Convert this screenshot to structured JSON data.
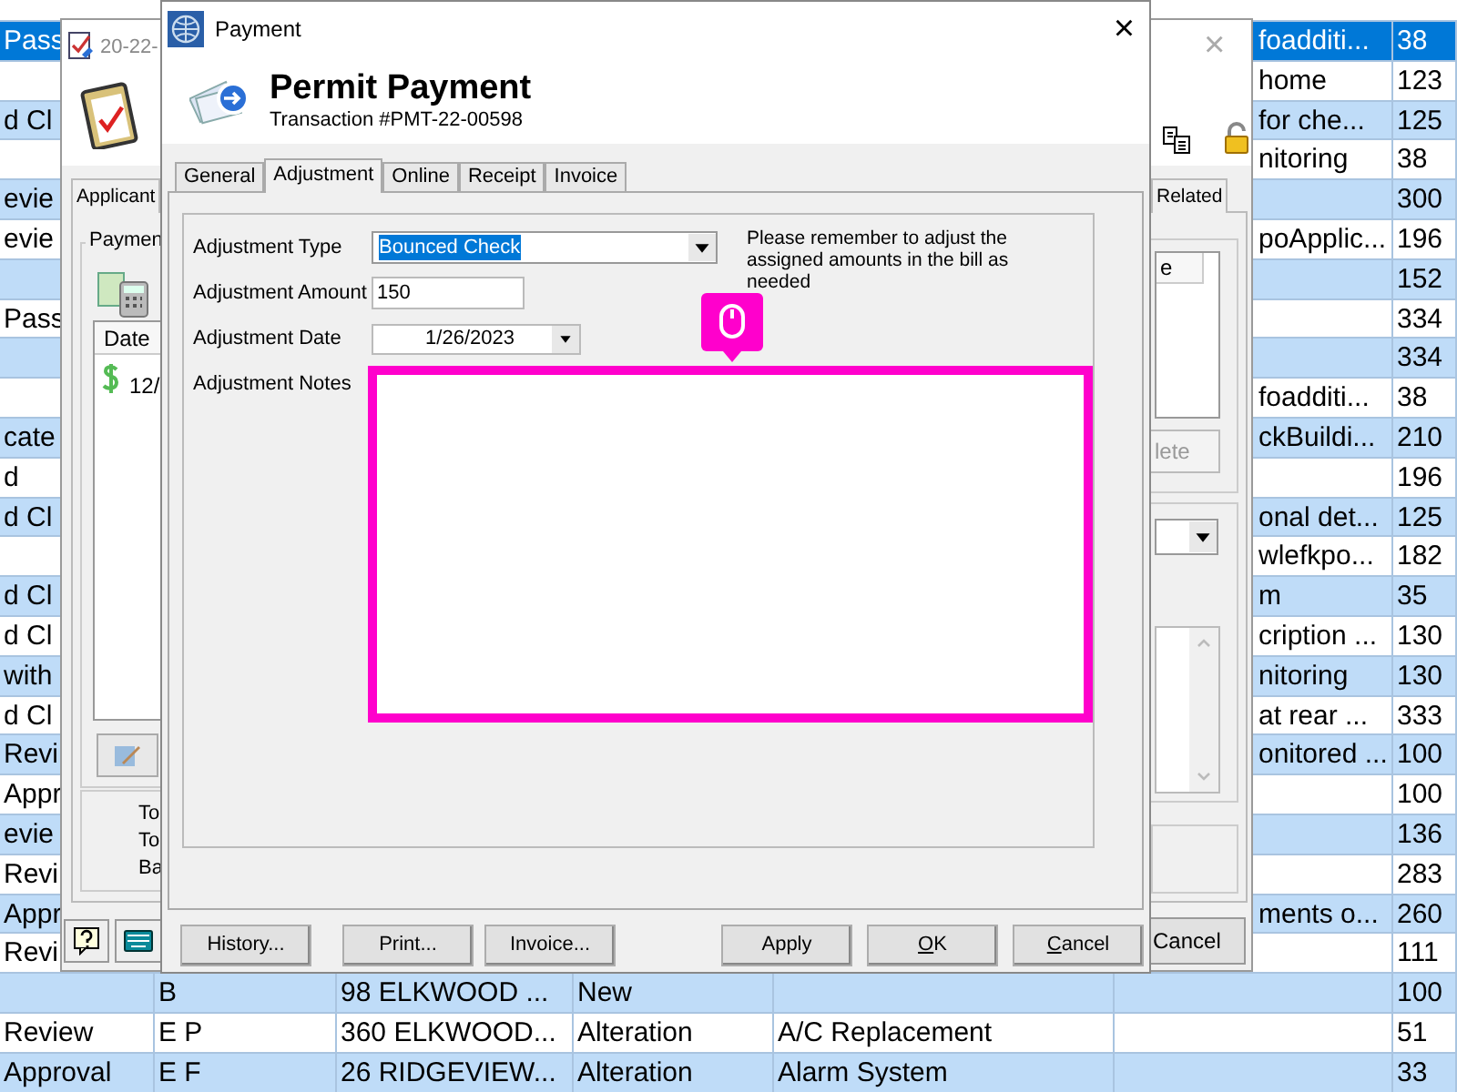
{
  "background_table": {
    "rows": [
      {
        "selected": true,
        "column_1": "Pass",
        "column_6": "foadditi...",
        "column_7": "38"
      },
      {
        "selected": false,
        "column_6": "home",
        "column_7": "123"
      },
      {
        "selected": false,
        "column_1": "d Cl",
        "column_6": "for che...",
        "column_7": "125"
      },
      {
        "selected": false,
        "column_6": "nitoring",
        "column_7": "38"
      },
      {
        "selected": false,
        "column_1": "evie",
        "column_7": "300"
      },
      {
        "selected": false,
        "column_1": "evie",
        "column_6": "poApplic...",
        "column_7": "196"
      },
      {
        "selected": false,
        "column_7": "152"
      },
      {
        "selected": false,
        "column_1": "Pass",
        "column_7": "334"
      },
      {
        "selected": false,
        "column_7": "334"
      },
      {
        "selected": false,
        "column_6": "foadditi...",
        "column_7": "38"
      },
      {
        "selected": false,
        "column_1": "cate",
        "column_6": "ckBuildi...",
        "column_7": "210"
      },
      {
        "selected": false,
        "column_1": "d",
        "column_7": "196"
      },
      {
        "selected": false,
        "column_1": "d Cl",
        "column_6": "onal det...",
        "column_7": "125"
      },
      {
        "selected": false,
        "column_6": "wlefkpo...",
        "column_7": "182"
      },
      {
        "selected": false,
        "column_1": "d Cl",
        "column_6": "m",
        "column_7": "35"
      },
      {
        "selected": false,
        "column_1": "d Cl",
        "column_6": "cription ...",
        "column_7": "130"
      },
      {
        "selected": false,
        "column_1": "with",
        "column_6": "nitoring",
        "column_7": "130"
      },
      {
        "selected": false,
        "column_1": "d Cl",
        "column_6": "at rear ...",
        "column_7": "333"
      },
      {
        "selected": false,
        "column_1": "Revi",
        "column_6": "onitored ...",
        "column_7": "100"
      },
      {
        "selected": false,
        "column_1": "Appr",
        "column_7": "100"
      },
      {
        "selected": false,
        "column_1": "evie",
        "column_7": "136"
      },
      {
        "selected": false,
        "column_1": "Revi",
        "column_7": "283"
      },
      {
        "selected": false,
        "column_1": "Appr",
        "column_6": "ments o...",
        "column_7": "260"
      },
      {
        "selected": false,
        "column_1": "Revi",
        "column_7": "111"
      },
      {
        "selected": false,
        "column_2": "B",
        "column_3": "98 ELKWOOD ...",
        "column_4": "New",
        "column_7": "100"
      },
      {
        "selected": false,
        "column_1": "Review",
        "column_2": "E P",
        "column_3": "360 ELKWOOD...",
        "column_4": "Alteration",
        "column_5": "A/C Replacement",
        "column_7": "51"
      },
      {
        "selected": false,
        "column_1": "Approval",
        "column_2": "E F",
        "column_3": "26 RIDGEVIEW...",
        "column_4": "Alteration",
        "column_5": "Alarm System",
        "column_7": "33"
      }
    ]
  },
  "permit_window": {
    "title": "20-22-",
    "close_button": "×",
    "tabs": [
      {
        "label": "Applicant",
        "selected": false
      },
      {
        "label": "Related",
        "selected": false
      }
    ],
    "payments_group": "Paymen",
    "list_header": "Date",
    "list_row": "12/",
    "right_list_header": "e",
    "delete_button": {
      "label": "lete",
      "disabled": true
    },
    "totals": [
      "To",
      "To",
      "Ba"
    ],
    "cancel_button": "Cancel"
  },
  "dialog": {
    "title": "Payment",
    "close_button": "×",
    "heading": "Permit Payment",
    "subheading": "Transaction #PMT-22-00598",
    "tabs": [
      {
        "label": "General",
        "selected": false
      },
      {
        "label": "Adjustment",
        "selected": true
      },
      {
        "label": "Online",
        "selected": false
      },
      {
        "label": "Receipt",
        "selected": false
      },
      {
        "label": "Invoice",
        "selected": false
      }
    ],
    "fields": [
      {
        "kind": "select",
        "label": "Adjustment Type",
        "value": "Bounced Check"
      },
      {
        "kind": "text",
        "label": "Adjustment Amount",
        "value": "150"
      },
      {
        "kind": "date",
        "label": "Adjustment Date",
        "value": "1/26/2023"
      },
      {
        "kind": "notes",
        "label": "Adjustment Notes",
        "highlighted": true
      }
    ],
    "note": "Please remember to adjust the assigned amounts in the bill as needed",
    "left_buttons": [
      {
        "label": "History...",
        "underline_first": false
      },
      {
        "label": "Print...",
        "underline_first": false
      },
      {
        "label": "Invoice...",
        "underline_first": false
      }
    ],
    "right_buttons": [
      {
        "label": "Apply",
        "underline_first": false
      },
      {
        "label": "OK",
        "underline_first": true
      },
      {
        "label": "Cancel",
        "underline_first": true
      }
    ]
  }
}
